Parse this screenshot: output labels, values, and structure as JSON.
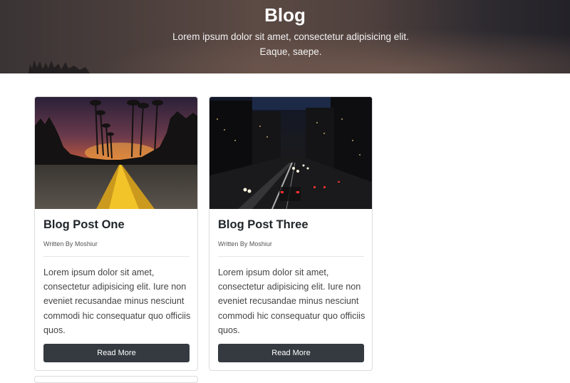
{
  "hero": {
    "title": "Blog",
    "subtitle": "Lorem ipsum dolor sit amet, consectetur adipisicing elit. Eaque, saepe."
  },
  "posts": [
    {
      "title": "Blog Post One",
      "author": "Written By Moshiur",
      "body": "Lorem ipsum dolor sit amet, consectetur adipisicing elit. Iure non eveniet recusandae minus nesciunt commodi hic consequatur quo officiis quos.",
      "button": "Read More"
    },
    {
      "title": "Blog Post Three",
      "author": "Written By Moshiur",
      "body": "Lorem ipsum dolor sit amet, consectetur adipisicing elit. Iure non eveniet recusandae minus nesciunt commodi hic consequatur quo officiis quos.",
      "button": "Read More"
    }
  ],
  "colors": {
    "button_bg": "#343a40",
    "title_text": "#212529",
    "card_border": "#dcdcdc"
  }
}
